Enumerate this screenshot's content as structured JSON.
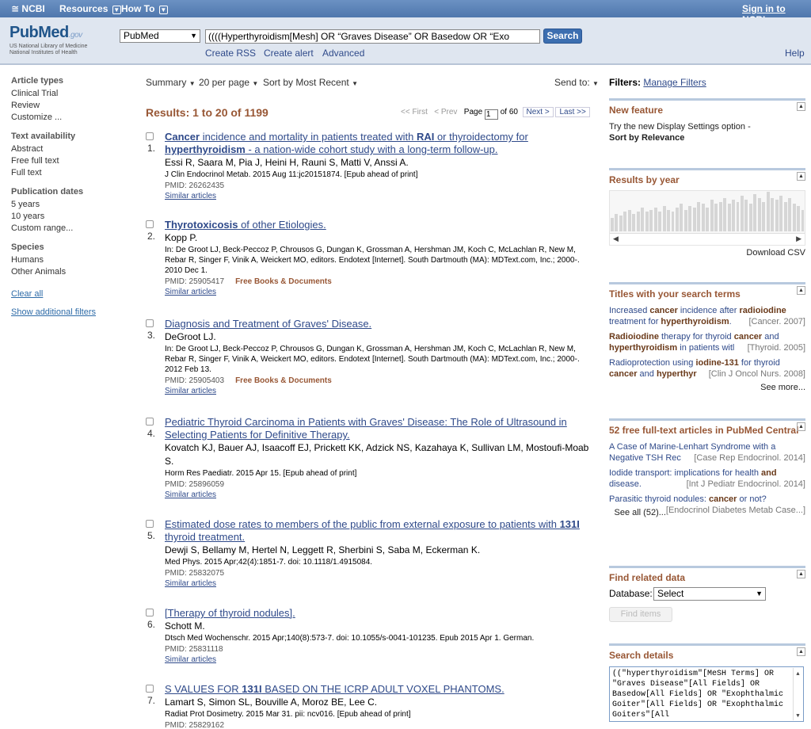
{
  "topbar": {
    "ncbi": "NCBI",
    "resources": "Resources",
    "howto": "How To",
    "signin": "Sign in to NCBI"
  },
  "header": {
    "logo_main": "PubMed",
    "logo_gov": ".gov",
    "logo_sub1": "US National Library of Medicine",
    "logo_sub2": "National Institutes of Health",
    "db_select": "PubMed",
    "query": "((((Hyperthyroidism[Mesh] OR “Graves Disease” OR Basedow OR “Exo",
    "search_btn": "Search",
    "links": [
      "Create RSS",
      "Create alert",
      "Advanced"
    ],
    "help": "Help"
  },
  "leftbar": {
    "article_types": {
      "heading": "Article types",
      "items": [
        "Clinical Trial",
        "Review",
        "Customize ..."
      ]
    },
    "text_avail": {
      "heading": "Text availability",
      "items": [
        "Abstract",
        "Free full text",
        "Full text"
      ]
    },
    "pub_dates": {
      "heading": "Publication dates",
      "items": [
        "5 years",
        "10 years",
        "Custom range..."
      ]
    },
    "species": {
      "heading": "Species",
      "items": [
        "Humans",
        "Other Animals"
      ]
    },
    "clear_all": "Clear all",
    "show_filters": "Show additional filters"
  },
  "toolbar": {
    "summary": "Summary",
    "per_page": "20 per page",
    "sort": "Sort by Most Recent",
    "send_to": "Send to:"
  },
  "results_head": "Results: 1 to 20 of 1199",
  "pager": {
    "first": "<< First",
    "prev": "< Prev",
    "page_label": "Page",
    "page_value": "1",
    "of": "of 60",
    "next": "Next >",
    "last": "Last >>"
  },
  "results": [
    {
      "num": "1.",
      "title_html": "<b>Cancer</b> incidence and mortality in patients treated with <b>RAI</b> or thyroidectomy for <b>hyperthyroidism</b> - a nation-wide cohort study with a long-term follow-up.",
      "authors": "Essi R, Saara M, Pia J, Heini H, Rauni S, Matti V, Anssi A.",
      "cite": "J Clin Endocrinol Metab. 2015 Aug 11:jc20151874. [Epub ahead of print]",
      "pmid": "PMID: 26262435",
      "free": "",
      "similar": "Similar articles"
    },
    {
      "num": "2.",
      "title_html": "<b>Thyrotoxicosis</b> of other Etiologies.",
      "authors": "Kopp P.",
      "cite": "In: De Groot LJ, Beck-Peccoz P, Chrousos G, Dungan K, Grossman A, Hershman JM, Koch C, McLachlan R, New M, Rebar R, Singer F, Vinik A, Weickert MO, editors. Endotext [Internet]. South Dartmouth (MA): MDText.com, Inc.; 2000-. 2010 Dec 1.",
      "pmid": "PMID: 25905417",
      "free": "Free Books & Documents",
      "similar": "Similar articles"
    },
    {
      "num": "3.",
      "title_html": "Diagnosis and Treatment of Graves' Disease.",
      "authors": "DeGroot LJ.",
      "cite": "In: De Groot LJ, Beck-Peccoz P, Chrousos G, Dungan K, Grossman A, Hershman JM, Koch C, McLachlan R, New M, Rebar R, Singer F, Vinik A, Weickert MO, editors. Endotext [Internet]. South Dartmouth (MA): MDText.com, Inc.; 2000-. 2012 Feb 13.",
      "pmid": "PMID: 25905403",
      "free": "Free Books & Documents",
      "similar": "Similar articles"
    },
    {
      "num": "4.",
      "title_html": "Pediatric Thyroid Carcinoma in Patients with Graves' Disease: The Role of Ultrasound in Selecting Patients for Definitive Therapy.",
      "authors": "Kovatch KJ, Bauer AJ, Isaacoff EJ, Prickett KK, Adzick NS, Kazahaya K, Sullivan LM, Mostoufi-Moab S.",
      "cite": "Horm Res Paediatr. 2015 Apr 15. [Epub ahead of print]",
      "pmid": "PMID: 25896059",
      "free": "",
      "similar": "Similar articles"
    },
    {
      "num": "5.",
      "title_html": "Estimated dose rates to members of the public from external exposure to patients with <b>131I</b> thyroid treatment.",
      "authors": "Dewji S, Bellamy M, Hertel N, Leggett R, Sherbini S, Saba M, Eckerman K.",
      "cite": "Med Phys. 2015 Apr;42(4):1851-7. doi: 10.1118/1.4915084.",
      "pmid": "PMID: 25832075",
      "free": "",
      "similar": "Similar articles"
    },
    {
      "num": "6.",
      "title_html": "[Therapy of thyroid nodules].",
      "authors": "Schott M.",
      "cite": "Dtsch Med Wochenschr. 2015 Apr;140(8):573-7. doi: 10.1055/s-0041-101235. Epub 2015 Apr 1. German.",
      "pmid": "PMID: 25831118",
      "free": "",
      "similar": "Similar articles"
    },
    {
      "num": "7.",
      "title_html": "S VALUES FOR <b>131I</b> BASED ON THE ICRP ADULT VOXEL PHANTOMS.",
      "authors": "Lamart S, Simon SL, Bouville A, Moroz BE, Lee C.",
      "cite": "Radiat Prot Dosimetry. 2015 Mar 31. pii: ncv016. [Epub ahead of print]",
      "pmid": "PMID: 25829162",
      "free": "",
      "similar": ""
    }
  ],
  "right": {
    "filters_label": "Filters:",
    "manage_filters": "Manage Filters",
    "new_feature": {
      "heading": "New feature",
      "text1": "Try the new Display Settings option -",
      "text2": "Sort by Relevance"
    },
    "by_year": {
      "heading": "Results by year",
      "download": "Download CSV",
      "bars": [
        0.35,
        0.45,
        0.4,
        0.5,
        0.55,
        0.45,
        0.5,
        0.6,
        0.5,
        0.55,
        0.6,
        0.5,
        0.65,
        0.55,
        0.5,
        0.6,
        0.7,
        0.55,
        0.65,
        0.6,
        0.75,
        0.7,
        0.6,
        0.8,
        0.7,
        0.75,
        0.85,
        0.7,
        0.8,
        0.75,
        0.9,
        0.8,
        0.7,
        0.95,
        0.85,
        0.75,
        1.0,
        0.85,
        0.8,
        0.9,
        0.75,
        0.85,
        0.7,
        0.65,
        0.55
      ]
    },
    "titles": {
      "heading": "Titles with your search terms",
      "items": [
        {
          "html": "Increased <b class='hl'>cancer</b> incidence after <b class='hl'>radioiodine</b> treatment for <b class='hl'>hyperthyroidism</b>.",
          "src": "[Cancer. 2007]"
        },
        {
          "html": "<b class='hl'>Radioiodine</b> therapy for thyroid <b class='hl'>cancer</b> and <b class='hl'>hyperthyroidism</b> in patients witl",
          "src": "[Thyroid. 2005]"
        },
        {
          "html": "Radioprotection using <b class='hl'>iodine-131</b> for thyroid <b class='hl'>cancer</b> and <b class='hl'>hyperthyr</b>",
          "src": "[Clin J Oncol Nurs. 2008]"
        }
      ],
      "more": "See more..."
    },
    "free_text": {
      "heading": "52 free full-text articles in PubMed Central",
      "items": [
        {
          "html": "A Case of Marine-Lenhart Syndrome with a Negative TSH Rec",
          "src": "[Case Rep Endocrinol. 2014]"
        },
        {
          "html": "Iodide transport: implications for health <b class='hl'>and</b> disease.",
          "src": "[Int J Pediatr Endocrinol. 2014]"
        },
        {
          "html": "Parasitic thyroid nodules: <b class='hl'>cancer</b> or not?",
          "src": "[Endocrinol Diabetes Metab Case...]"
        }
      ],
      "more": "See all (52)..."
    },
    "related": {
      "heading": "Find related data",
      "db_label": "Database:",
      "db_value": "Select",
      "find": "Find items"
    },
    "details": {
      "heading": "Search details",
      "text": "((\"hyperthyroidism\"[MeSH Terms] OR \"Graves Disease\"[All Fields] OR Basedow[All Fields] OR \"Exophthalmic Goiter\"[All Fields] OR \"Exophthalmic Goiters\"[All"
    }
  }
}
